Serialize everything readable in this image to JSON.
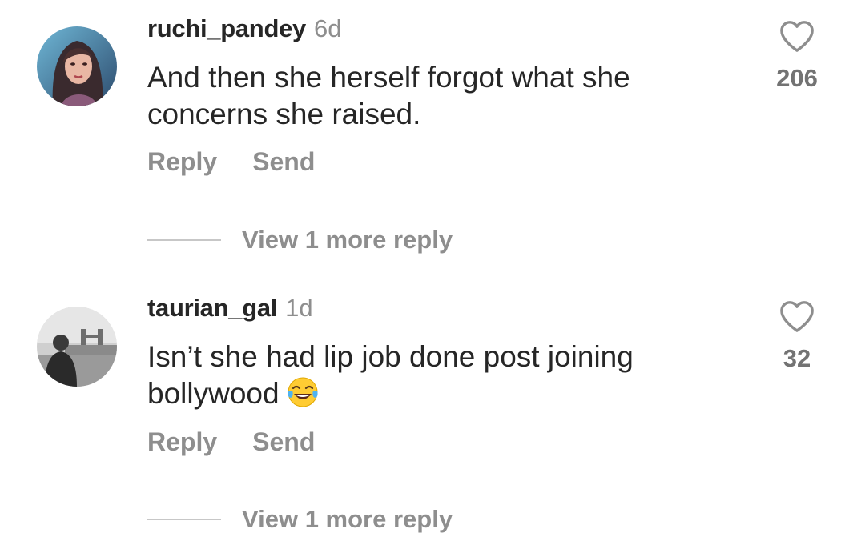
{
  "comments": [
    {
      "username": "ruchi_pandey",
      "time": "6d",
      "text": "And then she herself forgot what she concerns she raised.",
      "likes": "206",
      "reply_label": "Reply",
      "send_label": "Send",
      "view_more": "View 1 more reply",
      "avatar_icon": "avatar-woman-portrait"
    },
    {
      "username": "taurian_gal",
      "time": "1d",
      "text": "Isn’t she had lip job done post joining bollywood",
      "emoji": "tears-of-joy-emoji",
      "likes": "32",
      "reply_label": "Reply",
      "send_label": "Send",
      "view_more": "View 1 more reply",
      "avatar_icon": "avatar-city-bridge-photo"
    }
  ],
  "icons": {
    "like": "heart-outline-icon"
  },
  "colors": {
    "primary_text": "#262626",
    "secondary_text": "#8e8e8e",
    "like_count": "#737373",
    "divider": "#c7c7c7"
  }
}
